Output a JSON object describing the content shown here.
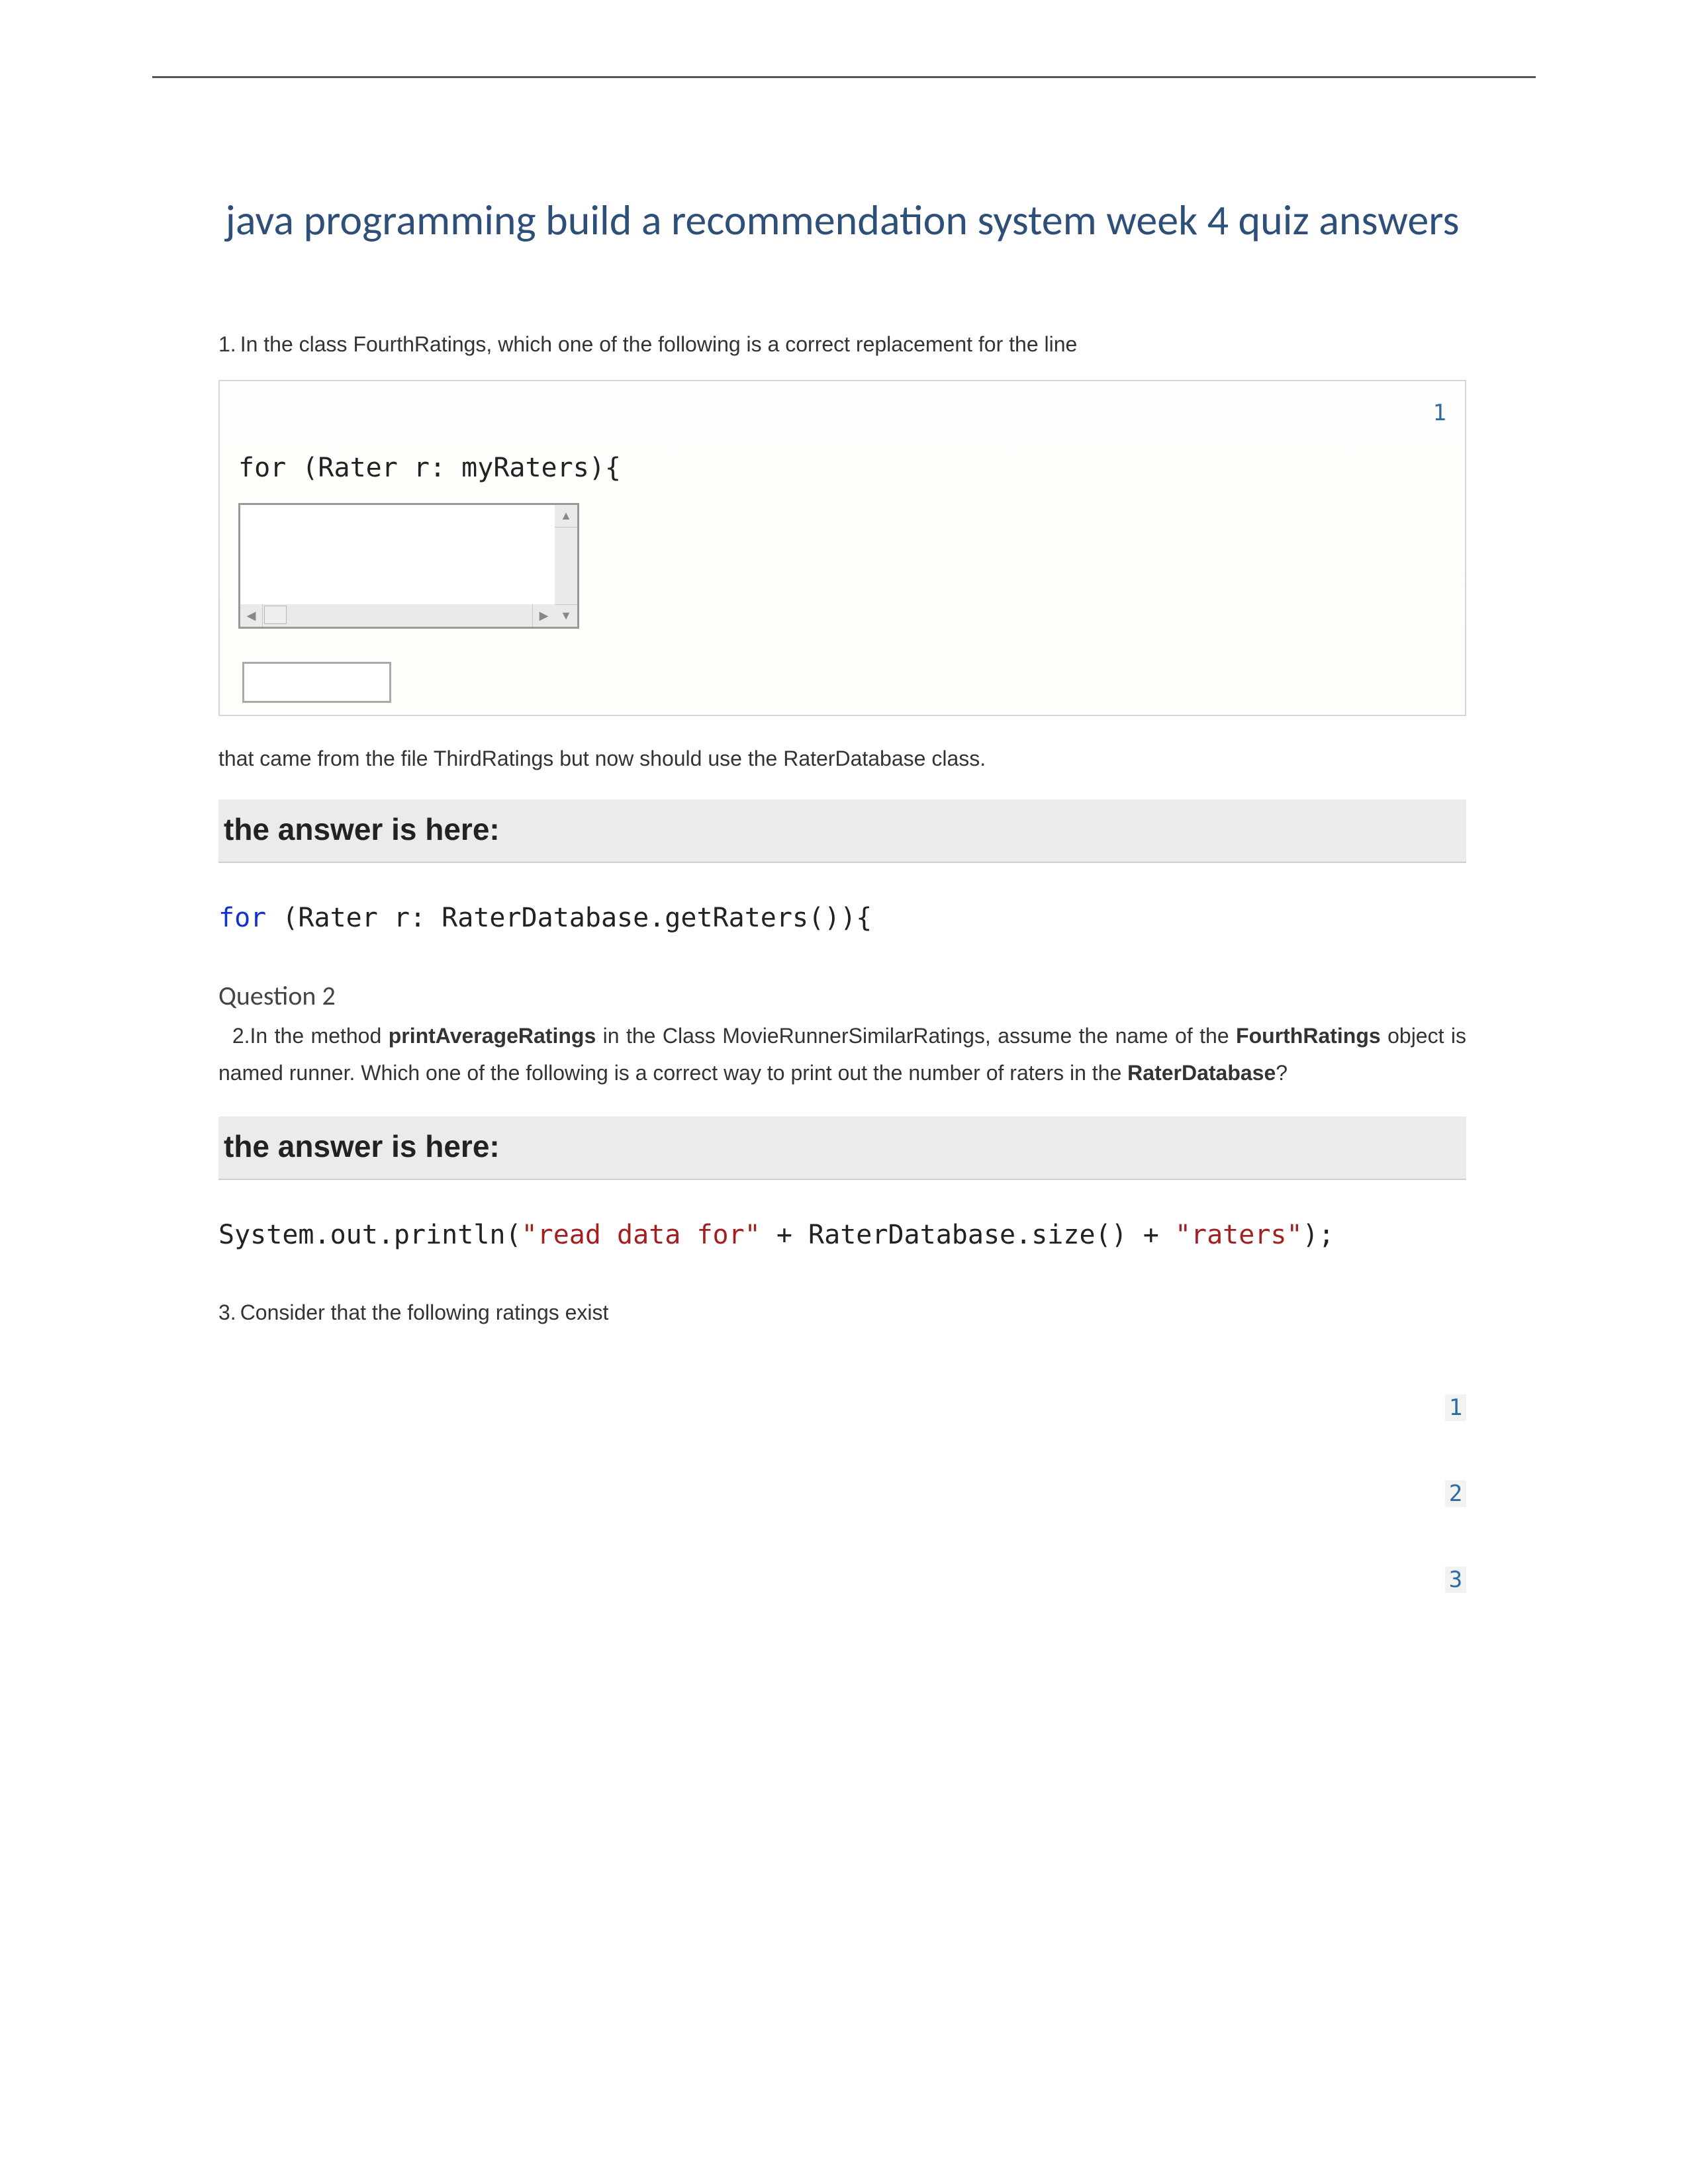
{
  "title": "java programming build a recommendation system week 4 quiz answers",
  "q1": {
    "num": "1.",
    "text": "In the class FourthRatings, which one of the following is a correct replacement for the line",
    "codebox_linenum": "1",
    "codebox_code": "for (Rater r: myRaters){",
    "after": "that came from the file ThirdRatings but now should use the RaterDatabase class."
  },
  "answer_label": "the answer is here:",
  "a1": {
    "kw": "for",
    "rest": " (Rater r: RaterDatabase.getRaters()){"
  },
  "q2": {
    "head": "Question 2",
    "num": "2.",
    "part1": "In the method ",
    "b1": "printAverageRatings",
    "part2": " in the Class MovieRunnerSimilarRatings, assume the name of the ",
    "b2": "FourthRatings",
    "part3": " object is named runner. Which one of the following is a correct way to print out the number of raters in the ",
    "b3": "RaterDatabase",
    "part4": "?"
  },
  "a2": {
    "pre": "System.out.println(",
    "s1": "\"read data for\"",
    "mid": " + RaterDatabase.size() + ",
    "s2": "\"raters\"",
    "post": ");"
  },
  "q3": {
    "num": "3.",
    "text": "Consider that the following ratings exist",
    "nums": [
      "1",
      "2",
      "3"
    ]
  }
}
